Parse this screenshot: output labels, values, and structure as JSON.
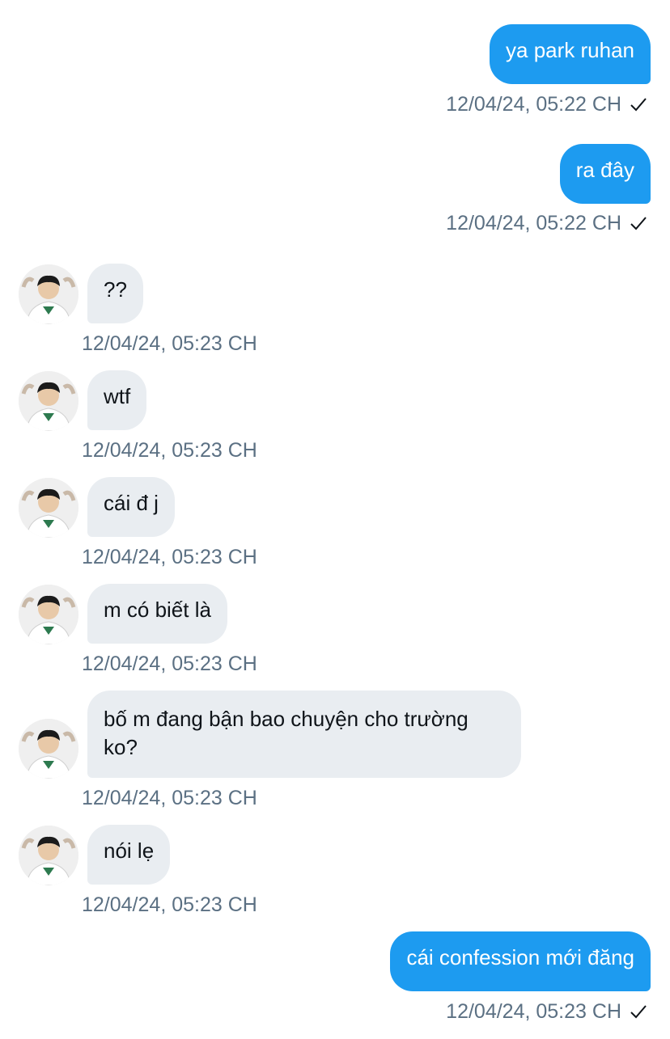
{
  "messages": [
    {
      "direction": "outgoing",
      "text": "ya park ruhan",
      "time": "12/04/24, 05:22 CH",
      "status_icon": "checkmark-icon"
    },
    {
      "direction": "outgoing",
      "text": "ra đây",
      "time": "12/04/24, 05:22 CH",
      "status_icon": "checkmark-icon"
    },
    {
      "direction": "incoming",
      "text": "??",
      "time": "12/04/24, 05:23 CH"
    },
    {
      "direction": "incoming",
      "text": "wtf",
      "time": "12/04/24, 05:23 CH"
    },
    {
      "direction": "incoming",
      "text": "cái đ j",
      "time": "12/04/24, 05:23 CH"
    },
    {
      "direction": "incoming",
      "text": "m có biết là",
      "time": "12/04/24, 05:23 CH"
    },
    {
      "direction": "incoming",
      "text": "bố m đang bận bao chuyện cho trường ko?",
      "time": "12/04/24, 05:23 CH"
    },
    {
      "direction": "incoming",
      "text": "nói lẹ",
      "time": "12/04/24, 05:23 CH"
    },
    {
      "direction": "outgoing",
      "text": "cái confession mới đăng",
      "time": "12/04/24, 05:23 CH",
      "status_icon": "checkmark-icon"
    }
  ],
  "colors": {
    "outgoing_bubble": "#1d9bf0",
    "incoming_bubble": "#e9edf1",
    "timestamp": "#5b7083"
  }
}
